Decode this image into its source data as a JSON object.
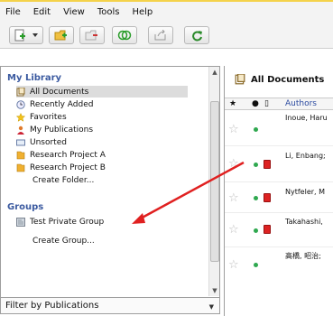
{
  "menu": [
    "File",
    "Edit",
    "View",
    "Tools",
    "Help"
  ],
  "toolbar": {
    "buttons": [
      "new-document-icon",
      "add-folder-icon",
      "remove-folder-icon",
      "sync-group-icon",
      "share-icon",
      "refresh-icon"
    ]
  },
  "library": {
    "heading": "My Library",
    "items": [
      {
        "label": "All Documents",
        "icon": "documents-icon",
        "selected": true
      },
      {
        "label": "Recently Added",
        "icon": "clock-icon"
      },
      {
        "label": "Favorites",
        "icon": "star-icon"
      },
      {
        "label": "My Publications",
        "icon": "person-icon"
      },
      {
        "label": "Unsorted",
        "icon": "tray-icon"
      },
      {
        "label": "Research Project A",
        "icon": "folder-icon"
      },
      {
        "label": "Research Project B",
        "icon": "folder-icon"
      },
      {
        "label": "Create Folder..."
      }
    ]
  },
  "groups": {
    "heading": "Groups",
    "items": [
      {
        "label": "Test Private Group",
        "icon": "group-icon"
      },
      {
        "label": "Create Group..."
      }
    ]
  },
  "filter": {
    "label": "Filter by Publications"
  },
  "documents": {
    "title": "All Documents",
    "columns": {
      "authors": "Authors"
    },
    "rows": [
      {
        "author": "Inoue, Haru",
        "pdf": false
      },
      {
        "author": "Li, Enbang;",
        "pdf": true
      },
      {
        "author": "Nytfeler, M",
        "pdf": true
      },
      {
        "author": "Takahashi,",
        "pdf": true
      },
      {
        "author": "高橋, 昭治;",
        "pdf": false
      }
    ]
  },
  "colors": {
    "accent": "#3b5aa0",
    "arrow": "#e02020",
    "status_dot": "#2fa84f"
  }
}
